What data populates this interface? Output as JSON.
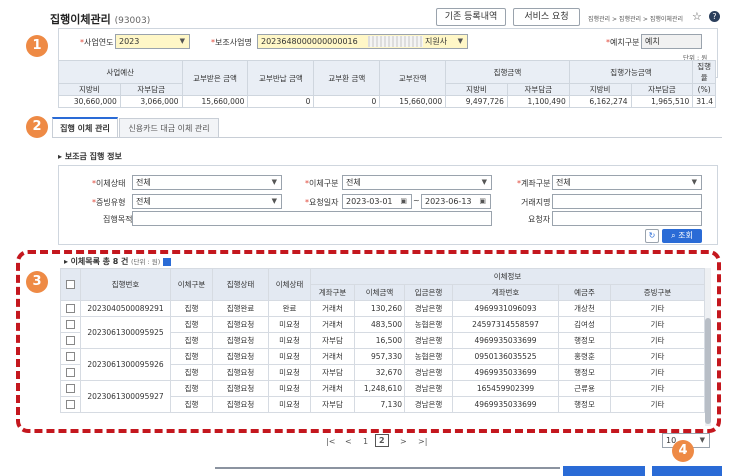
{
  "header": {
    "title": "집행이체관리",
    "code": "(93003)",
    "btn_prev": "기존 등록내역",
    "btn_service": "서비스 요청",
    "breadcrumb": "집행관리 > 집행관리 > 집행이체관리"
  },
  "badges": [
    "1",
    "2",
    "3",
    "4"
  ],
  "filters": {
    "year_label": "사업연도",
    "year_value": "2023",
    "sub_label": "보조사업명",
    "sub_value": "2023648000000000016",
    "sub_suffix": "지원사",
    "deposit_label": "예치구분",
    "deposit_value": "예치",
    "unit": "단위 : 원"
  },
  "summary": {
    "h_budget": "사업예산",
    "h_grant": "교부받은 금액",
    "h_return": "교부반납 금액",
    "h_refund": "교부환 금액",
    "h_balance": "교부잔액",
    "h_exec": "집행금액",
    "h_avail": "집행가능금액",
    "h_rate": "집행율",
    "h_rate_unit": "(%)",
    "h_gov": "지방비",
    "h_self": "자부담금",
    "values": [
      "30,660,000",
      "3,066,000",
      "15,660,000",
      "0",
      "0",
      "15,660,000",
      "9,497,726",
      "1,100,490",
      "6,162,274",
      "1,965,510",
      "31.4"
    ]
  },
  "tabs": [
    "집행 이체 관리",
    "신용카드 대금 이체 관리"
  ],
  "section_title": "보조금 집행 정보",
  "form": {
    "status_label": "이체상태",
    "status_value": "전체",
    "type_label": "이체구분",
    "type_value": "전체",
    "account_label": "계좌구분",
    "account_value": "전체",
    "proof_label": "증빙유형",
    "proof_value": "전체",
    "date_label": "요청일자",
    "date_from": "2023-03-01",
    "date_to": "2023-06-13",
    "bank_label": "거래지명",
    "purpose_label": "집행목적",
    "requester_label": "요청자",
    "search_btn": "조회"
  },
  "list": {
    "title": "이체목록",
    "count": "총 8 건",
    "unit": "(단위 : 원)",
    "headers": {
      "no": "집행번호",
      "tr_type": "이체구분",
      "exec_status": "집행상태",
      "tr_status": "이체상태",
      "info": "이체정보",
      "acct_type": "계좌구분",
      "amount": "이체금액",
      "bank": "입금은행",
      "acct_no": "계좌번호",
      "holder": "예금주",
      "proof": "증빙구분"
    },
    "groups": [
      {
        "no": "2023040500089291",
        "rows": [
          [
            "집행",
            "집행완료",
            "완료",
            "거래처",
            "130,260",
            "경남은행",
            "4969931096093",
            "개상천",
            "기타"
          ]
        ]
      },
      {
        "no": "2023061300095925",
        "rows": [
          [
            "집행",
            "집행요청",
            "미요청",
            "거래처",
            "483,500",
            "농협은행",
            "24597314558597",
            "김여성",
            "기타"
          ],
          [
            "집행",
            "집행요청",
            "미요청",
            "자부담",
            "16,500",
            "경남은행",
            "4969935033699",
            "행정모",
            "기타"
          ]
        ]
      },
      {
        "no": "2023061300095926",
        "rows": [
          [
            "집행",
            "집행요청",
            "미요청",
            "거래처",
            "957,330",
            "농협은행",
            "0950136035525",
            "홍령훈",
            "기타"
          ],
          [
            "집행",
            "집행요청",
            "미요청",
            "자부담",
            "32,670",
            "경남은행",
            "4969935033699",
            "행정모",
            "기타"
          ]
        ]
      },
      {
        "no": "2023061300095927",
        "rows": [
          [
            "집행",
            "집행요청",
            "미요청",
            "거래처",
            "1,248,610",
            "경남은행",
            "165459902399",
            "근류용",
            "기타"
          ],
          [
            "집행",
            "집행요청",
            "미요청",
            "자부담",
            "7,130",
            "경남은행",
            "4969935033699",
            "행정모",
            "기타"
          ]
        ]
      }
    ]
  },
  "pagination": {
    "first": "|<",
    "prev": "<",
    "pages": [
      "1",
      "2"
    ],
    "next": ">",
    "last": ">|",
    "page_size": "10"
  },
  "colors": {
    "badge": "#ee8a45",
    "dash": "#c4171e",
    "primary": "#2a6bd6",
    "header": "#e3e9f2"
  }
}
